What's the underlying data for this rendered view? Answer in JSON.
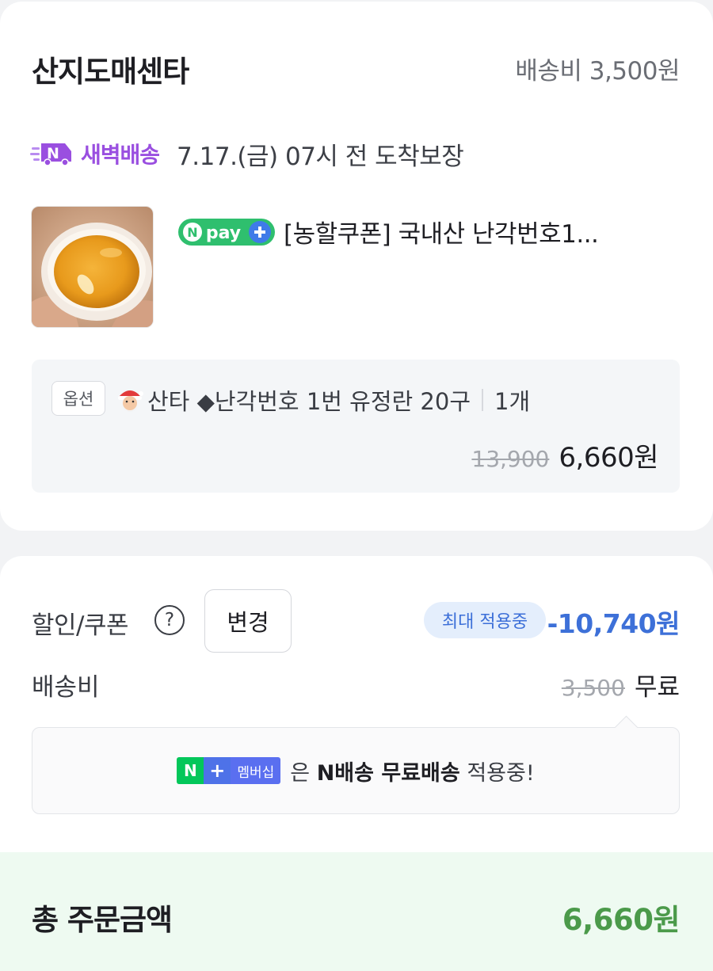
{
  "store": {
    "name": "산지도매센타",
    "shipping_fee": "배송비 3,500원"
  },
  "dawn_delivery": {
    "badge_letter": "N",
    "label": "새벽배송",
    "guarantee": "7.17.(금) 07시 전 도착보장",
    "color": "#9a4fe0"
  },
  "product": {
    "npay_badge": "pay",
    "title": "[농할쿠폰] 국내산 난각번호1...",
    "thumbnail": "egg-yolk-image"
  },
  "option": {
    "tag": "옵션",
    "text": "산타 ◆난각번호 1번 유정란 20구",
    "quantity": "1개",
    "original_price": "13,900",
    "sale_price": "6,660원"
  },
  "discount": {
    "label": "할인/쿠폰",
    "help_icon": "?",
    "change_button": "변경",
    "max_badge": "최대 적용중",
    "amount": "-10,740원",
    "accent": "#3d70d8"
  },
  "shipping": {
    "label": "배송비",
    "original": "3,500",
    "value": "무료"
  },
  "membership": {
    "badge_n": "N",
    "badge_plus": "+",
    "badge_text": "멤버십",
    "msg_prefix": "은 ",
    "msg_bold": "N배송 무료배송",
    "msg_suffix": " 적용중!"
  },
  "total": {
    "label": "총 주문금액",
    "amount": "6,660원",
    "color": "#4b9a4a"
  }
}
